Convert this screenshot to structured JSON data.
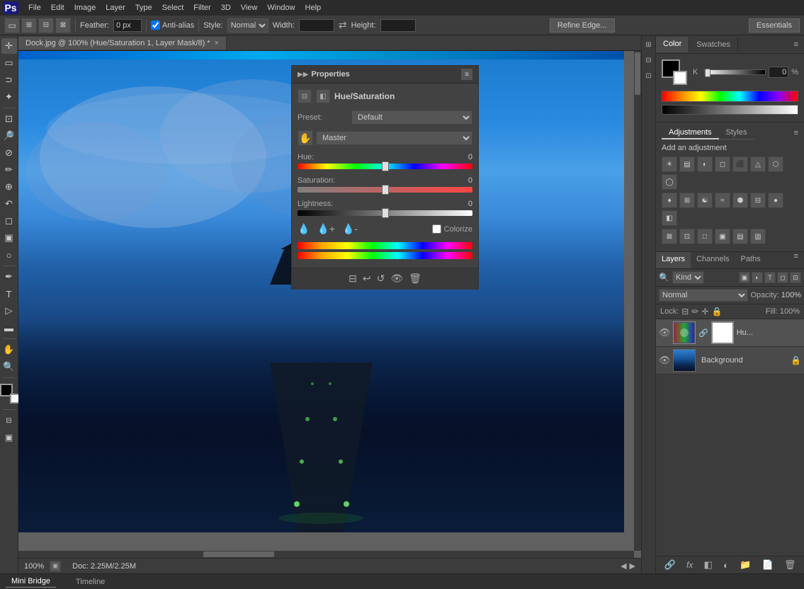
{
  "app": {
    "title": "Photoshop",
    "logo": "Ps"
  },
  "menu": {
    "items": [
      "File",
      "Edit",
      "Image",
      "Layer",
      "Type",
      "Select",
      "Filter",
      "3D",
      "View",
      "Window",
      "Help"
    ]
  },
  "options_bar": {
    "feather_label": "Feather:",
    "feather_value": "0 px",
    "anti_alias": "Anti-alias",
    "style_label": "Style:",
    "style_value": "Normal",
    "width_label": "Width:",
    "height_label": "Height:",
    "refine_edge": "Refine Edge...",
    "essentials": "Essentials"
  },
  "canvas": {
    "tab_title": "Dock.jpg @ 100% (Hue/Saturation 1, Layer Mask/8) *",
    "zoom": "100%",
    "doc_info": "Doc: 2.25M/2.25M"
  },
  "properties": {
    "title": "Properties",
    "panel_title": "Hue/Saturation",
    "preset_label": "Preset:",
    "preset_value": "Default",
    "channel_label": "Master",
    "hue_label": "Hue:",
    "hue_value": "0",
    "hue_position": "50%",
    "saturation_label": "Saturation:",
    "saturation_value": "0",
    "saturation_position": "50%",
    "lightness_label": "Lightness:",
    "lightness_value": "0",
    "lightness_position": "50%",
    "colorize_label": "Colorize"
  },
  "color_panel": {
    "color_tab": "Color",
    "swatches_tab": "Swatches",
    "k_label": "K",
    "k_value": "0",
    "k_percent": "%"
  },
  "adjustments": {
    "title": "Adjustments",
    "styles_tab": "Styles",
    "add_adjustment": "Add an adjustment",
    "icons": [
      "☀",
      "≡",
      "◐",
      "◻",
      "⬛",
      "△",
      "⬡",
      "◯",
      "♦",
      "⊞",
      "☯",
      "≈",
      "⋯",
      "⬢",
      "⊟",
      "●",
      "◧",
      "⊠",
      "⊡",
      "□"
    ]
  },
  "layers": {
    "layers_tab": "Layers",
    "channels_tab": "Channels",
    "paths_tab": "Paths",
    "search_placeholder": "Kind",
    "blend_mode": "Normal",
    "opacity_label": "Opacity:",
    "opacity_value": "100%",
    "lock_label": "Lock:",
    "fill_label": "Fill:",
    "fill_value": "100%",
    "items": [
      {
        "name": "Hu...",
        "visible": true,
        "type": "adjustment"
      },
      {
        "name": "Background",
        "visible": true,
        "type": "image",
        "locked": true
      }
    ]
  },
  "status_bar": {
    "mini_bridge": "Mini Bridge",
    "timeline": "Timeline"
  }
}
